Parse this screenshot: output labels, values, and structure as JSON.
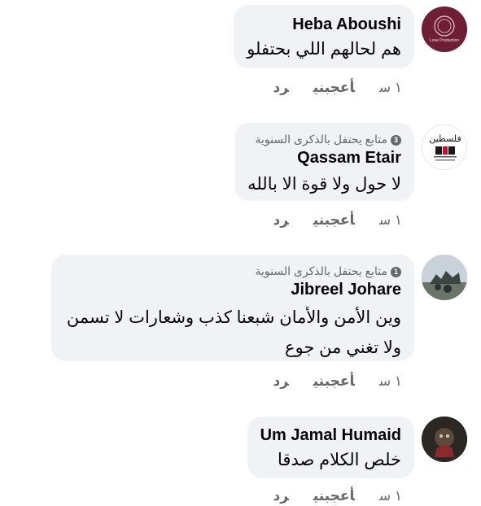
{
  "comments": [
    {
      "name": "Heba Aboushi",
      "badge": "",
      "text": "هم لحالهم اللي بحتفلو",
      "time": "١ س",
      "like": "أعجبني",
      "reply": "رد",
      "avatar_text": "Love Production"
    },
    {
      "name": "Qassam Etair",
      "badge_count": "3",
      "badge": "متابع يحتفل بالذكرى السنوية",
      "text": "لا حول ولا قوة الا بالله",
      "time": "١ س",
      "like": "أعجبني",
      "reply": "رد",
      "avatar_text": "فلسطين"
    },
    {
      "name": "Jibreel Johare",
      "badge_count": "1",
      "badge": "متابع يحتفل بالذكرى السنوية",
      "text": "وين الأمن والأمان شبعنا كذب وشعارات لا تسمن ولا تغني من جوع",
      "time": "١ س",
      "like": "أعجبني",
      "reply": "رد"
    },
    {
      "name": "Um Jamal Humaid",
      "badge": "",
      "text": "خلص الكلام صدقا",
      "time": "١ س",
      "like": "أعجبني",
      "reply": "رد"
    }
  ],
  "colors": {
    "bubble": "#f0f2f5",
    "secondary_text": "#65676b",
    "avatar1": "#6e1f35"
  }
}
